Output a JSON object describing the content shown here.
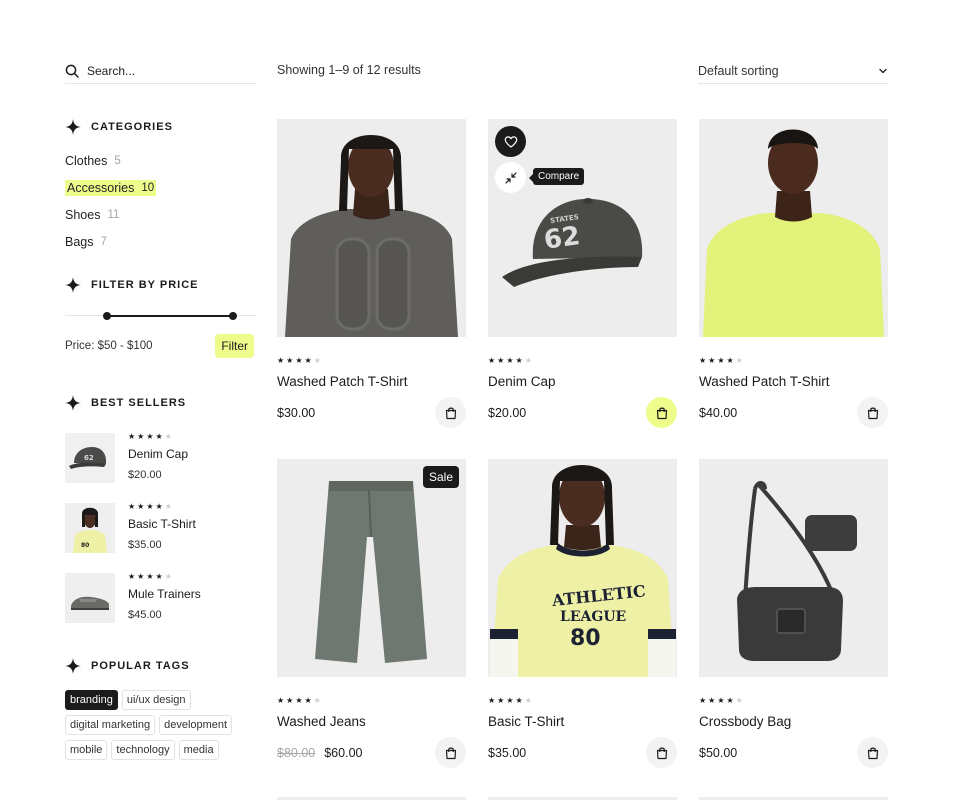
{
  "search": {
    "placeholder": "Search..."
  },
  "toolbar": {
    "result_count": "Showing 1–9 of 12 results",
    "sorting": "Default sorting"
  },
  "categories": {
    "title": "CATEGORIES",
    "items": [
      {
        "label": "Clothes",
        "count": "5"
      },
      {
        "label": "Accessories",
        "count": "10",
        "active": true
      },
      {
        "label": "Shoes",
        "count": "11"
      },
      {
        "label": "Bags",
        "count": "7"
      }
    ]
  },
  "price_filter": {
    "title": "FILTER BY PRICE",
    "label": "Price: $50 - $100",
    "button": "Filter",
    "min_fraction": 0.22,
    "max_fraction": 0.88
  },
  "best_sellers": {
    "title": "BEST SELLERS",
    "items": [
      {
        "name": "Denim Cap",
        "price": "$20.00",
        "rating": 4
      },
      {
        "name": "Basic T-Shirt",
        "price": "$35.00",
        "rating": 4
      },
      {
        "name": "Mule Trainers",
        "price": "$45.00",
        "rating": 4
      }
    ]
  },
  "tags": {
    "title": "POPULAR TAGS",
    "items": [
      "branding",
      "ui/ux design",
      "digital marketing",
      "development",
      "mobile",
      "technology",
      "media"
    ]
  },
  "products": [
    {
      "name": "Washed Patch T-Shirt",
      "price": "$30.00",
      "rating": 4,
      "image": "grey-tshirt-model"
    },
    {
      "name": "Denim Cap",
      "price": "$20.00",
      "rating": 4,
      "image": "washed-cap",
      "compare_tooltip": "Compare"
    },
    {
      "name": "Washed Patch T-Shirt",
      "price": "$40.00",
      "rating": 4,
      "image": "lime-tshirt-model"
    },
    {
      "name": "Washed Jeans",
      "old_price": "$80.00",
      "price": "$60.00",
      "rating": 4,
      "badge": "Sale",
      "image": "jeans"
    },
    {
      "name": "Basic T-Shirt",
      "price": "$35.00",
      "rating": 4,
      "image": "athletic-league-tee-model"
    },
    {
      "name": "Crossbody Bag",
      "price": "$50.00",
      "rating": 4,
      "image": "crossbody-bag"
    }
  ],
  "colors": {
    "accent": "#eefc8c",
    "dark": "#1b1b1b",
    "image_bg": "#ededed"
  }
}
